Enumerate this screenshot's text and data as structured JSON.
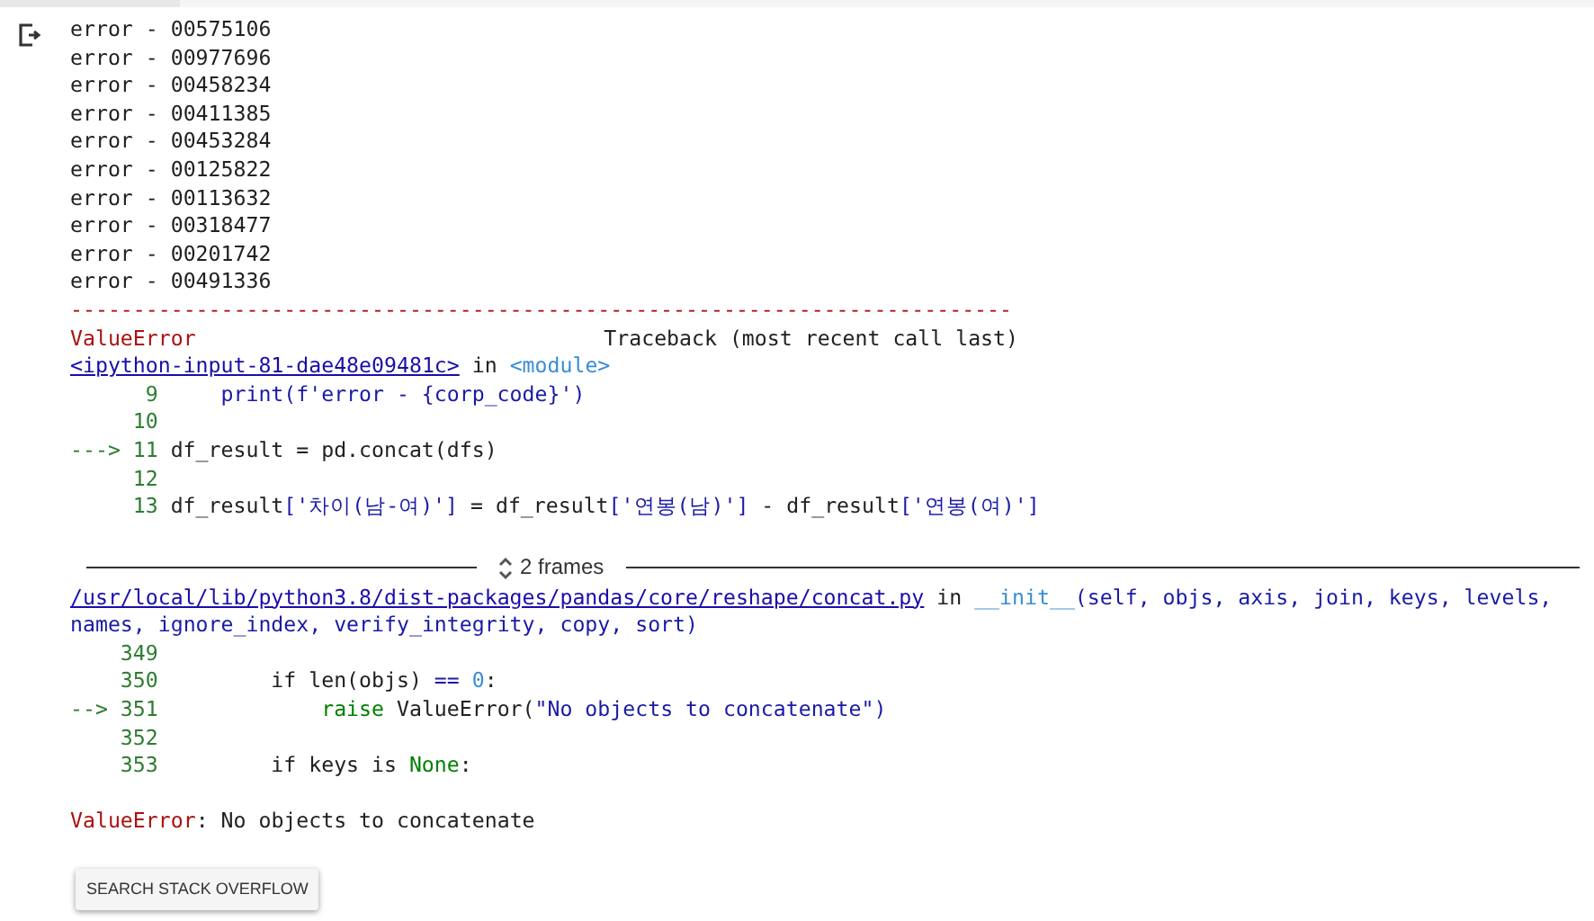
{
  "output_lines": [
    {
      "kind": "output",
      "text": "error - 00575106"
    },
    {
      "kind": "output",
      "text": "error - 00977696"
    },
    {
      "kind": "output",
      "text": "error - 00458234"
    },
    {
      "kind": "output",
      "text": "error - 00411385"
    },
    {
      "kind": "output",
      "text": "error - 00453284"
    },
    {
      "kind": "output",
      "text": "error - 00125822"
    },
    {
      "kind": "output",
      "text": "error - 00113632"
    },
    {
      "kind": "output",
      "text": "error - 00318477"
    },
    {
      "kind": "output",
      "text": "error - 00201742"
    },
    {
      "kind": "output",
      "text": "error - 00491336"
    },
    {
      "kind": "rule",
      "text": "---------------------------------------------------------------------------"
    },
    {
      "kind": "header",
      "name": "ValueError",
      "text": "Traceback (most recent call last)"
    },
    {
      "kind": "location",
      "file": "<ipython-input-81-dae48e09481c>",
      "text": "in",
      "function": "<module>"
    },
    {
      "kind": "source",
      "number": "9",
      "code": [
        {
          "kind": "string",
          "text": "    print(f'error - {corp_code}')"
        }
      ]
    },
    {
      "kind": "source",
      "number": "10"
    },
    {
      "kind": "source",
      "marker": "--->",
      "number": "11",
      "code": [
        {
          "kind": "name",
          "text": "df_result = pd.concat(dfs)"
        }
      ]
    },
    {
      "kind": "source",
      "number": "12"
    },
    {
      "kind": "source",
      "number": "13",
      "code": [
        {
          "kind": "name",
          "text": "df_result"
        },
        {
          "kind": "string",
          "text": "['차이(남-여)']"
        },
        {
          "kind": "name",
          "text": " = df_result"
        },
        {
          "kind": "string",
          "text": "['연봉(남)']"
        },
        {
          "kind": "name",
          "text": " - df_result"
        },
        {
          "kind": "string",
          "text": "['연봉(여)']"
        }
      ]
    }
  ],
  "frames_toggle": {
    "label": "2 frames"
  },
  "frame_lines": [
    {
      "kind": "location",
      "file": "/usr/local/lib/python3.8/dist-packages/pandas/core/reshape/concat.py",
      "text": "in",
      "function": "__init__",
      "args": "(self, objs, axis, join, keys, levels,"
    },
    {
      "kind": "continuation",
      "text": "names, ignore_index, verify_integrity, copy, sort)"
    },
    {
      "kind": "source",
      "number": "349"
    },
    {
      "kind": "source",
      "number": "350",
      "code": [
        {
          "kind": "name",
          "text": "        if len(objs) "
        },
        {
          "kind": "string",
          "text": "=="
        },
        {
          "kind": "literal",
          "text": " 0"
        },
        {
          "kind": "name",
          "text": ":"
        }
      ]
    },
    {
      "kind": "source",
      "marker": "-->",
      "number": "351",
      "code": [
        {
          "kind": "keyword",
          "text": "            raise"
        },
        {
          "kind": "name",
          "text": " ValueError("
        },
        {
          "kind": "string",
          "text": "\"No objects to concatenate\")"
        }
      ]
    },
    {
      "kind": "source",
      "number": "352"
    },
    {
      "kind": "source",
      "number": "353",
      "code": [
        {
          "kind": "name",
          "text": "        if keys is "
        },
        {
          "kind": "keyword",
          "text": "None"
        },
        {
          "kind": "name",
          "text": ":"
        }
      ]
    },
    {
      "kind": "blank"
    },
    {
      "kind": "error",
      "name": "ValueError",
      "text": ": No objects to concatenate"
    }
  ],
  "button": {
    "label": "SEARCH STACK OVERFLOW"
  }
}
